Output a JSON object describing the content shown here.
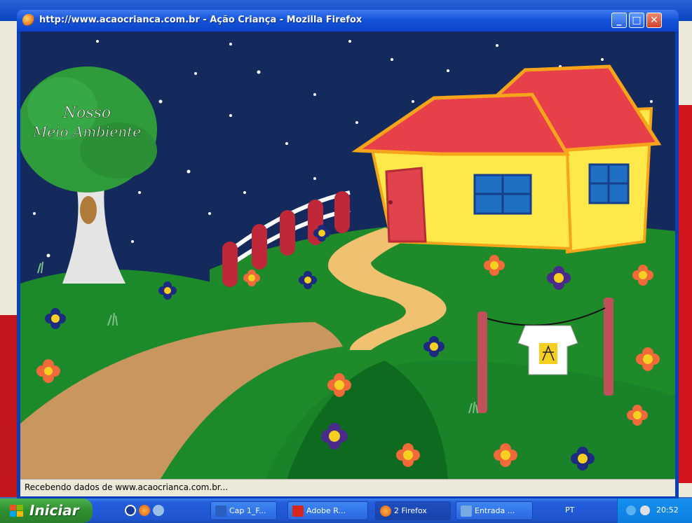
{
  "window": {
    "title": "http://www.acaocrianca.com.br - Ação Criança - Mozilla Firefox",
    "status_text": "Recebendo dados de www.acaocrianca.com.br..."
  },
  "scene": {
    "tree_text_line1": "Nosso",
    "tree_text_line2": "Meio Ambiente"
  },
  "taskbar": {
    "start_label": "Iniciar",
    "items": [
      {
        "label": "Cap 1_F..."
      },
      {
        "label": "Adobe R..."
      },
      {
        "label": "2 Firefox"
      },
      {
        "label": "Entrada ..."
      }
    ],
    "language": "PT",
    "clock": "20:52"
  },
  "colors": {
    "sky": "#142a5c",
    "grass": "#1f8a2a",
    "path": "#f0c170",
    "house_wall": "#ffe94a",
    "roof": "#e8404a",
    "taskbar": "#245edb",
    "title_bar": "#1553d9"
  }
}
